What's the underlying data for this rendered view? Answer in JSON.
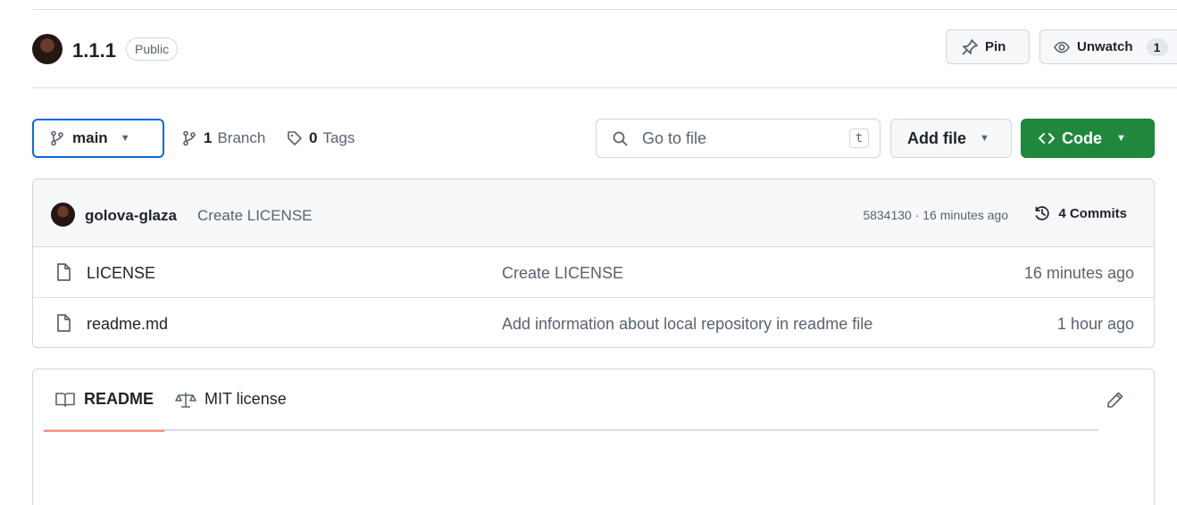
{
  "repository": {
    "name": "1.1.1",
    "visibility": "Public",
    "actions": {
      "pin_label": "Pin",
      "watch_label": "Unwatch",
      "watch_count": "1"
    }
  },
  "toolbar": {
    "branch": "main",
    "branch_count": "1",
    "branch_label": "Branch",
    "tag_count": "0",
    "tag_label": "Tags",
    "search_placeholder": "Go to file",
    "shortcut": "t",
    "add_file": "Add file",
    "code_button": "Code"
  },
  "latest_commit": {
    "author": "golova-glaza",
    "message": "Create LICENSE",
    "meta": "5834130 · 16 minutes ago",
    "commit_count": "4 Commits"
  },
  "files": [
    {
      "name": "LICENSE",
      "commit": "Create LICENSE",
      "time": "16 minutes ago"
    },
    {
      "name": "readme.md",
      "commit": "Add information about local repository in readme file",
      "time": "1 hour ago"
    }
  ],
  "readme": {
    "tabs": [
      {
        "label": "README",
        "active": true,
        "icon": "book-icon"
      },
      {
        "label": "MIT license",
        "active": false,
        "icon": "scale-icon"
      }
    ]
  },
  "colors": {
    "primary_button": "#1f883d",
    "focus_blue": "#0969da",
    "tab_accent": "#fd8c73",
    "border": "#d0d7de"
  },
  "icons": [
    "avatar",
    "pin-icon",
    "eye-icon",
    "branch-icon",
    "tag-icon",
    "search-icon",
    "code-icon",
    "history-icon",
    "file-icon",
    "book-icon",
    "scale-icon",
    "pencil-icon"
  ]
}
